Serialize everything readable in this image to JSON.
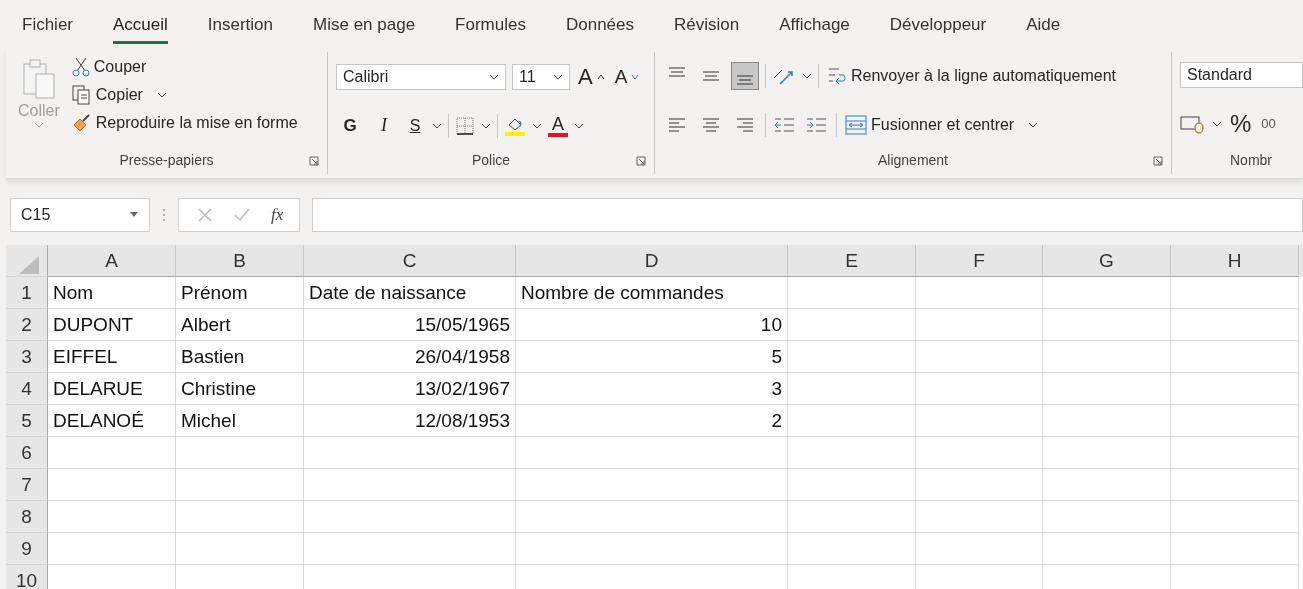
{
  "tabs": [
    {
      "label": "Fichier",
      "selected": false
    },
    {
      "label": "Accueil",
      "selected": true
    },
    {
      "label": "Insertion",
      "selected": false
    },
    {
      "label": "Mise en page",
      "selected": false
    },
    {
      "label": "Formules",
      "selected": false
    },
    {
      "label": "Données",
      "selected": false
    },
    {
      "label": "Révision",
      "selected": false
    },
    {
      "label": "Affichage",
      "selected": false
    },
    {
      "label": "Développeur",
      "selected": false
    },
    {
      "label": "Aide",
      "selected": false
    }
  ],
  "clipboard": {
    "paste": {
      "label": "Coller",
      "disabled": true
    },
    "cut": "Couper",
    "copy": "Copier",
    "format_painter": "Reproduire la mise en forme",
    "group_label": "Presse-papiers"
  },
  "font": {
    "font_name": "Calibri",
    "font_size": "11",
    "grow": "A",
    "shrink": "A",
    "bold": "G",
    "italic": "I",
    "underline": "S",
    "font_color": "A",
    "group_label": "Police"
  },
  "alignment": {
    "vertical_align": [
      {
        "selected": false
      },
      {
        "selected": false
      },
      {
        "selected": true
      }
    ],
    "wrap_text": "Renvoyer à la ligne automatiquement",
    "merge": "Fusionner et centrer",
    "group_label": "Alignement"
  },
  "number": {
    "format": "Standard",
    "percent": "%",
    "thousands": "00",
    "group_label": "Nombr"
  },
  "formula_bar": {
    "name_box": "C15",
    "function_label": "fx"
  },
  "sheet": {
    "columns": [
      "A",
      "B",
      "C",
      "D",
      "E",
      "F",
      "G",
      "H"
    ],
    "rows": [
      {
        "number": "1",
        "cells": [
          {
            "text": "Nom",
            "kind": "text"
          },
          {
            "text": "Prénom",
            "kind": "text"
          },
          {
            "text": "Date de naissance",
            "kind": "text"
          },
          {
            "text": "Nombre de commandes",
            "kind": "text"
          }
        ]
      },
      {
        "number": "2",
        "cells": [
          {
            "text": "DUPONT",
            "kind": "text"
          },
          {
            "text": "Albert",
            "kind": "text"
          },
          {
            "text": "15/05/1965",
            "kind": "number"
          },
          {
            "text": "10",
            "kind": "number"
          }
        ]
      },
      {
        "number": "3",
        "cells": [
          {
            "text": "EIFFEL",
            "kind": "text"
          },
          {
            "text": "Bastien",
            "kind": "text"
          },
          {
            "text": "26/04/1958",
            "kind": "number"
          },
          {
            "text": "5",
            "kind": "number"
          }
        ]
      },
      {
        "number": "4",
        "cells": [
          {
            "text": "DELARUE",
            "kind": "text"
          },
          {
            "text": "Christine",
            "kind": "text"
          },
          {
            "text": "13/02/1967",
            "kind": "number"
          },
          {
            "text": "3",
            "kind": "number"
          }
        ]
      },
      {
        "number": "5",
        "cells": [
          {
            "text": "DELANOÉ",
            "kind": "text"
          },
          {
            "text": "Michel",
            "kind": "text"
          },
          {
            "text": "12/08/1953",
            "kind": "number"
          },
          {
            "text": "2",
            "kind": "number"
          }
        ]
      },
      {
        "number": "6",
        "cells": []
      },
      {
        "number": "7",
        "cells": []
      },
      {
        "number": "8",
        "cells": []
      },
      {
        "number": "9",
        "cells": []
      },
      {
        "number": "10",
        "cells": []
      }
    ]
  }
}
